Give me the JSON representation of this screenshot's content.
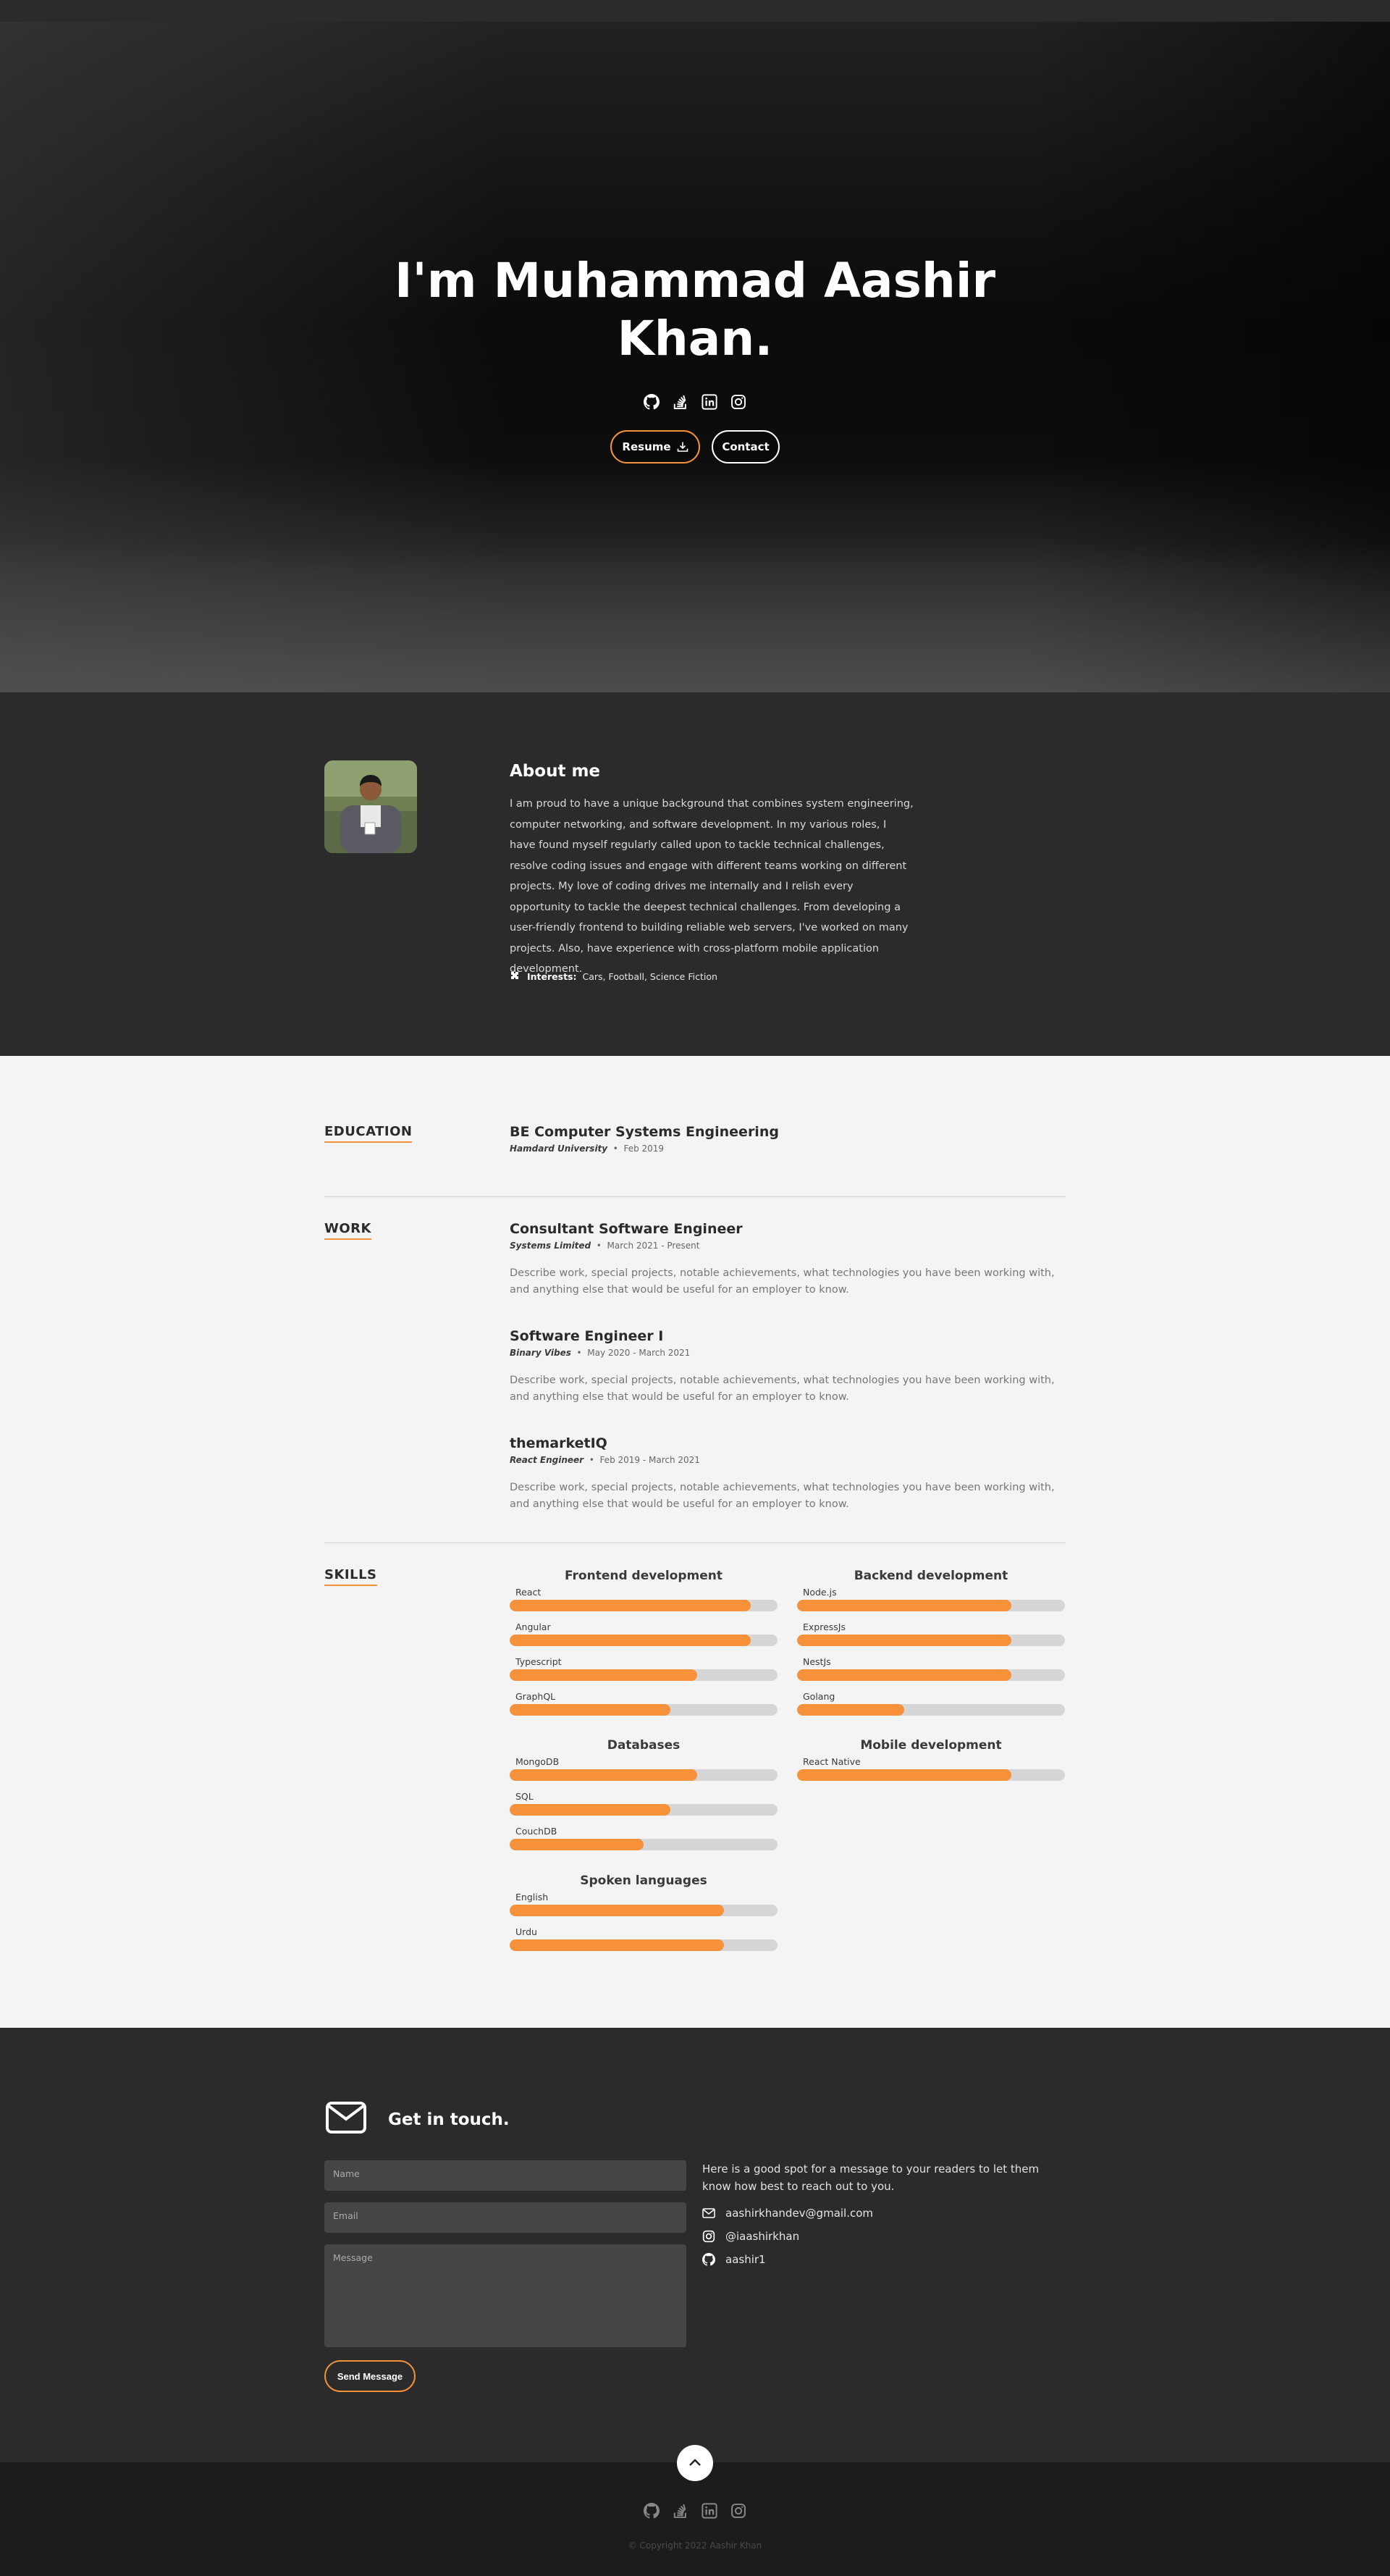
{
  "hero": {
    "title": "I'm Muhammad Aashir Khan.",
    "social_icons": [
      "github-icon",
      "stackoverflow-icon",
      "linkedin-icon",
      "instagram-icon"
    ],
    "resume_label": "Resume",
    "contact_label": "Contact"
  },
  "about": {
    "title": "About me",
    "text": "I am proud to have a unique background that combines system engineering, computer networking, and software development. In my various roles, I have found myself regularly called upon to tackle technical challenges, resolve coding issues and engage with different teams working on different projects. My love of coding drives me internally and I relish every opportunity to tackle the deepest technical challenges. From developing a user-friendly frontend to building reliable web servers, I've worked on many projects. Also, have experience with cross-platform mobile application development.",
    "interests_label": "Interests:",
    "interests_value": "Cars, Football, Science Fiction"
  },
  "education": {
    "label": "EDUCATION",
    "title": "BE Computer Systems Engineering",
    "org": "Hamdard University",
    "date": "Feb 2019"
  },
  "work": {
    "label": "WORK",
    "jobs": [
      {
        "title": "Consultant Software Engineer",
        "org": "Systems Limited",
        "date": "March 2021 - Present",
        "desc": "Describe work, special projects, notable achievements, what technologies you have been working with, and anything else that would be useful for an employer to know."
      },
      {
        "title": "Software Engineer I",
        "org": "Binary Vibes",
        "date": "May 2020 - March 2021",
        "desc": "Describe work, special projects, notable achievements, what technologies you have been working with, and anything else that would be useful for an employer to know."
      },
      {
        "title": "themarketIQ",
        "org": "React Engineer",
        "date": "Feb 2019 - March 2021",
        "desc": "Describe work, special projects, notable achievements, what technologies you have been working with, and anything else that would be useful for an employer to know."
      }
    ]
  },
  "skills": {
    "label": "SKILLS",
    "groups": [
      {
        "title": "Frontend development",
        "items": [
          {
            "name": "React",
            "level": 0.9
          },
          {
            "name": "Angular",
            "level": 0.9
          },
          {
            "name": "Typescript",
            "level": 0.7
          },
          {
            "name": "GraphQL",
            "level": 0.6
          }
        ]
      },
      {
        "title": "Backend development",
        "items": [
          {
            "name": "Node.js",
            "level": 0.8
          },
          {
            "name": "ExpressJs",
            "level": 0.8
          },
          {
            "name": "NestJs",
            "level": 0.8
          },
          {
            "name": "Golang",
            "level": 0.4
          }
        ]
      },
      {
        "title": "Databases",
        "items": [
          {
            "name": "MongoDB",
            "level": 0.7
          },
          {
            "name": "SQL",
            "level": 0.6
          },
          {
            "name": "CouchDB",
            "level": 0.5
          }
        ]
      },
      {
        "title": "Mobile development",
        "items": [
          {
            "name": "React Native",
            "level": 0.8
          }
        ]
      },
      {
        "title": "Spoken languages",
        "items": [
          {
            "name": "English",
            "level": 0.8
          },
          {
            "name": "Urdu",
            "level": 0.8
          }
        ]
      }
    ]
  },
  "contact": {
    "title": "Get in touch.",
    "name_placeholder": "Name",
    "email_placeholder": "Email",
    "message_placeholder": "Message",
    "send_label": "Send Message",
    "message": "Here is a good spot for a message to your readers to let them know how best to reach out to you.",
    "email": "aashirkhandev@gmail.com",
    "instagram": "@iaashirkhan",
    "github": "aashir1"
  },
  "footer": {
    "copyright": "© Copyright 2022 Aashir Khan"
  },
  "colors": {
    "accent": "#f7923a",
    "dark": "#2b2b2b",
    "light": "#f4f4f4"
  }
}
